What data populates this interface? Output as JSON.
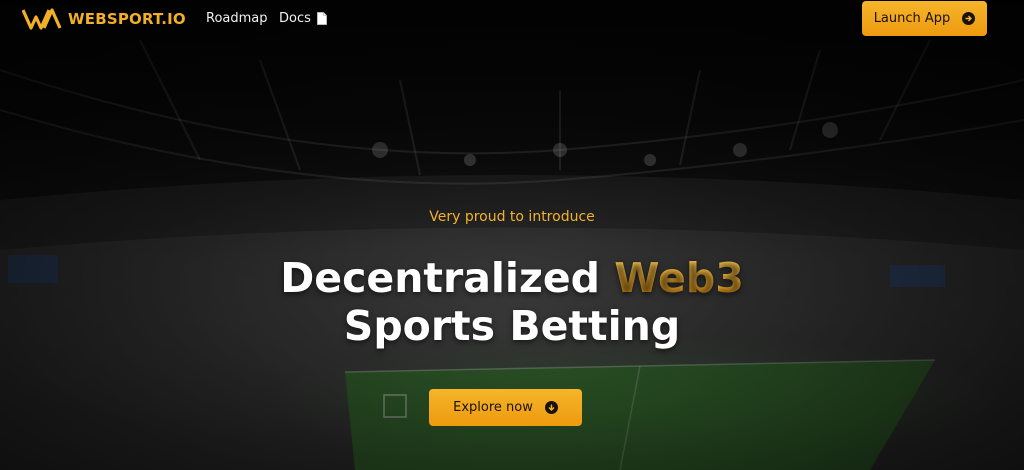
{
  "brand": {
    "name": "WEBSPORT.IO",
    "accent_color": "#f3b027"
  },
  "nav": {
    "links": [
      {
        "label": "Roadmap"
      },
      {
        "label": "Docs",
        "icon": "document-icon"
      }
    ],
    "launch_button": {
      "label": "Launch App",
      "icon": "arrow-right-circle-icon"
    }
  },
  "hero": {
    "intro": "Very proud to introduce",
    "headline_part1": "Decentralized ",
    "headline_accent": "Web3",
    "headline_line2": "Sports Betting",
    "explore_button": {
      "label": "Explore now",
      "icon": "arrow-down-circle-icon"
    }
  },
  "colors": {
    "button_gradient_start": "#f5b52a",
    "button_gradient_end": "#ee9a0f",
    "background": "#0b0b0b"
  }
}
